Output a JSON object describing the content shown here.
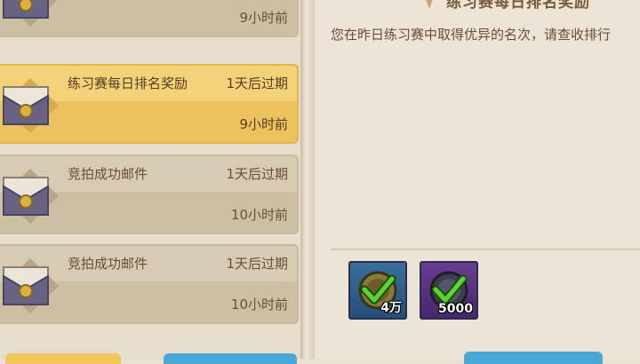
{
  "mails": [
    {
      "title": "",
      "expire": "",
      "time": "9小时前",
      "selected": false
    },
    {
      "title": "练习赛每日排名奖励",
      "expire": "1天后过期",
      "time": "9小时前",
      "selected": true
    },
    {
      "title": "竞拍成功邮件",
      "expire": "1天后过期",
      "time": "10小时前",
      "selected": false
    },
    {
      "title": "竞拍成功邮件",
      "expire": "1天后过期",
      "time": "10小时前",
      "selected": false
    }
  ],
  "detail": {
    "heading": "练习赛每日排名奖励",
    "body": "您在昨日练习赛中取得优异的名次，请查收排行",
    "rewards": [
      {
        "icon": "gold-coin-icon",
        "qty": "4万"
      },
      {
        "icon": "purple-gem-icon",
        "qty": "5000"
      }
    ]
  },
  "colors": {
    "selected_bg": "#f3d27a",
    "item_bg": "#d7cbb4",
    "text": "#6a4e37",
    "check": "#5bd52f"
  }
}
